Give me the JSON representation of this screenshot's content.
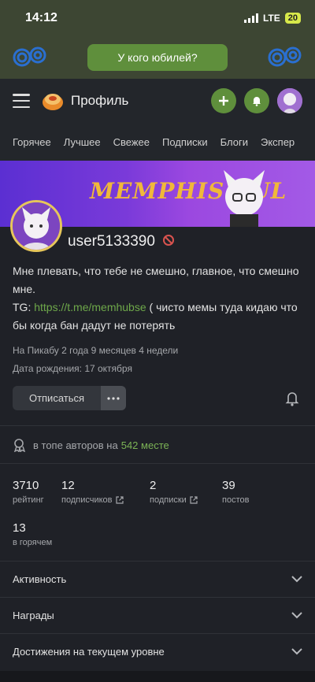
{
  "status": {
    "time": "14:12",
    "network": "LTE",
    "battery": "20"
  },
  "banner": {
    "button": "У кого юбилей?"
  },
  "topbar": {
    "title": "Профиль"
  },
  "tabs": [
    "Горячее",
    "Лучшее",
    "Свежее",
    "Подписки",
    "Блоги",
    "Экспер"
  ],
  "cover": {
    "text": "MEMPHIS.CUL"
  },
  "profile": {
    "username": "user5133390",
    "bio_line1": "Мне плевать, что тебе не смешно, главное, что смешно мне.",
    "bio_tg_prefix": "TG: ",
    "bio_link": "https://t.me/memhubse",
    "bio_suffix": " ( чисто мемы туда кидаю что бы когда бан дадут не потерять",
    "on_site": "На Пикабу 2 года 9 месяцев 4 недели",
    "birthday": "Дата рождения: 17 октября",
    "unsubscribe": "Отписаться"
  },
  "rank": {
    "prefix": "в топе авторов на",
    "place": "542 месте"
  },
  "stats": [
    {
      "num": "3710",
      "label": "рейтинг"
    },
    {
      "num": "12",
      "label": "подписчиков"
    },
    {
      "num": "2",
      "label": "подписки"
    },
    {
      "num": "39",
      "label": "постов"
    },
    {
      "num": "13",
      "label": "в горячем"
    }
  ],
  "sections": [
    "Активность",
    "Награды",
    "Достижения на текущем уровне"
  ],
  "colors": {
    "accent": "#5f8f3c",
    "link": "#6ea84a",
    "background": "#1f2127"
  }
}
